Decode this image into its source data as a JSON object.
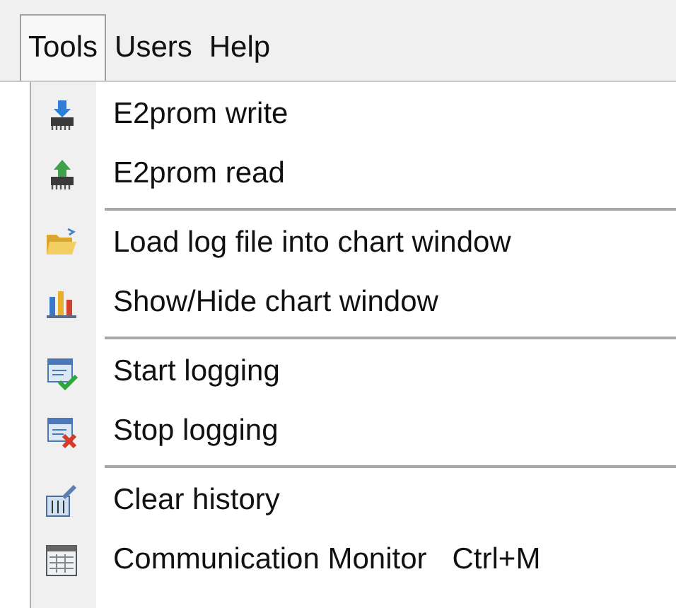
{
  "menu_bar": [
    {
      "label": "Tools",
      "selected": true
    },
    {
      "label": "Users",
      "selected": false
    },
    {
      "label": "Help",
      "selected": false
    }
  ],
  "menu": {
    "items": [
      {
        "kind": "item",
        "label": "E2prom write"
      },
      {
        "kind": "item",
        "label": "E2prom read"
      },
      {
        "kind": "separator"
      },
      {
        "kind": "item",
        "label": "Load log file into chart window"
      },
      {
        "kind": "item",
        "label": "Show/Hide chart window"
      },
      {
        "kind": "separator"
      },
      {
        "kind": "item",
        "label": "Start logging"
      },
      {
        "kind": "item",
        "label": "Stop logging"
      },
      {
        "kind": "separator"
      },
      {
        "kind": "item",
        "label": "Clear history"
      },
      {
        "kind": "item",
        "label": "Communication Monitor",
        "shortcut": "Ctrl+M"
      }
    ]
  }
}
